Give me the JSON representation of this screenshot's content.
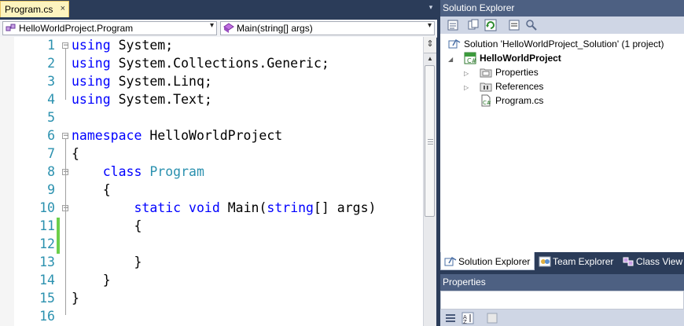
{
  "editor": {
    "tab": {
      "label": "Program.cs",
      "close": "×"
    },
    "tab_dropdown": "▾",
    "nav": {
      "left_combo": "HelloWorldProject.Program",
      "right_combo": "Main(string[] args)",
      "arrow": "▾"
    },
    "lines": [
      {
        "n": "1",
        "tokens": [
          [
            "kw",
            "using"
          ],
          [
            "pl",
            " System;"
          ]
        ]
      },
      {
        "n": "2",
        "tokens": [
          [
            "kw",
            "using"
          ],
          [
            "pl",
            " System.Collections.Generic;"
          ]
        ]
      },
      {
        "n": "3",
        "tokens": [
          [
            "kw",
            "using"
          ],
          [
            "pl",
            " System.Linq;"
          ]
        ]
      },
      {
        "n": "4",
        "tokens": [
          [
            "kw",
            "using"
          ],
          [
            "pl",
            " System.Text;"
          ]
        ]
      },
      {
        "n": "5",
        "tokens": []
      },
      {
        "n": "6",
        "tokens": [
          [
            "kw",
            "namespace"
          ],
          [
            "pl",
            " HelloWorldProject"
          ]
        ]
      },
      {
        "n": "7",
        "tokens": [
          [
            "pl",
            "{"
          ]
        ]
      },
      {
        "n": "8",
        "tokens": [
          [
            "pl",
            "    "
          ],
          [
            "kw",
            "class"
          ],
          [
            "pl",
            " "
          ],
          [
            "ty",
            "Program"
          ]
        ]
      },
      {
        "n": "9",
        "tokens": [
          [
            "pl",
            "    {"
          ]
        ]
      },
      {
        "n": "10",
        "tokens": [
          [
            "pl",
            "        "
          ],
          [
            "kw",
            "static"
          ],
          [
            "pl",
            " "
          ],
          [
            "kw",
            "void"
          ],
          [
            "pl",
            " Main("
          ],
          [
            "kw",
            "string"
          ],
          [
            "pl",
            "[] args)"
          ]
        ]
      },
      {
        "n": "11",
        "tokens": [
          [
            "pl",
            "        {"
          ]
        ]
      },
      {
        "n": "12",
        "tokens": []
      },
      {
        "n": "13",
        "tokens": [
          [
            "pl",
            "        }"
          ]
        ]
      },
      {
        "n": "14",
        "tokens": [
          [
            "pl",
            "    }"
          ]
        ]
      },
      {
        "n": "15",
        "tokens": [
          [
            "pl",
            "}"
          ]
        ]
      },
      {
        "n": "16",
        "tokens": []
      }
    ],
    "fold_glyph": "−",
    "split_glyph": "⇕",
    "scroll_up": "▲"
  },
  "solution_explorer": {
    "title": "Solution Explorer",
    "nodes": [
      {
        "label": "Solution 'HelloWorldProject_Solution' (1 project)",
        "icon": "solution-icon"
      },
      {
        "label": "HelloWorldProject",
        "icon": "csharp-project-icon",
        "expander": "◢"
      },
      {
        "label": "Properties",
        "icon": "properties-folder-icon",
        "expander": "▷"
      },
      {
        "label": "References",
        "icon": "references-folder-icon",
        "expander": "▷"
      },
      {
        "label": "Program.cs",
        "icon": "csharp-file-icon"
      }
    ],
    "bottom_tabs": [
      {
        "label": "Solution Explorer",
        "icon": "solution-explorer-icon"
      },
      {
        "label": "Team Explorer",
        "icon": "team-explorer-icon"
      },
      {
        "label": "Class View",
        "icon": "class-view-icon"
      }
    ]
  },
  "properties": {
    "title": "Properties"
  },
  "colors": {
    "keyword": "#0000ff",
    "type": "#2b91af",
    "line_number": "#2b91af",
    "changed_marker": "#6ccf4b",
    "chrome": "#2b3c59"
  }
}
